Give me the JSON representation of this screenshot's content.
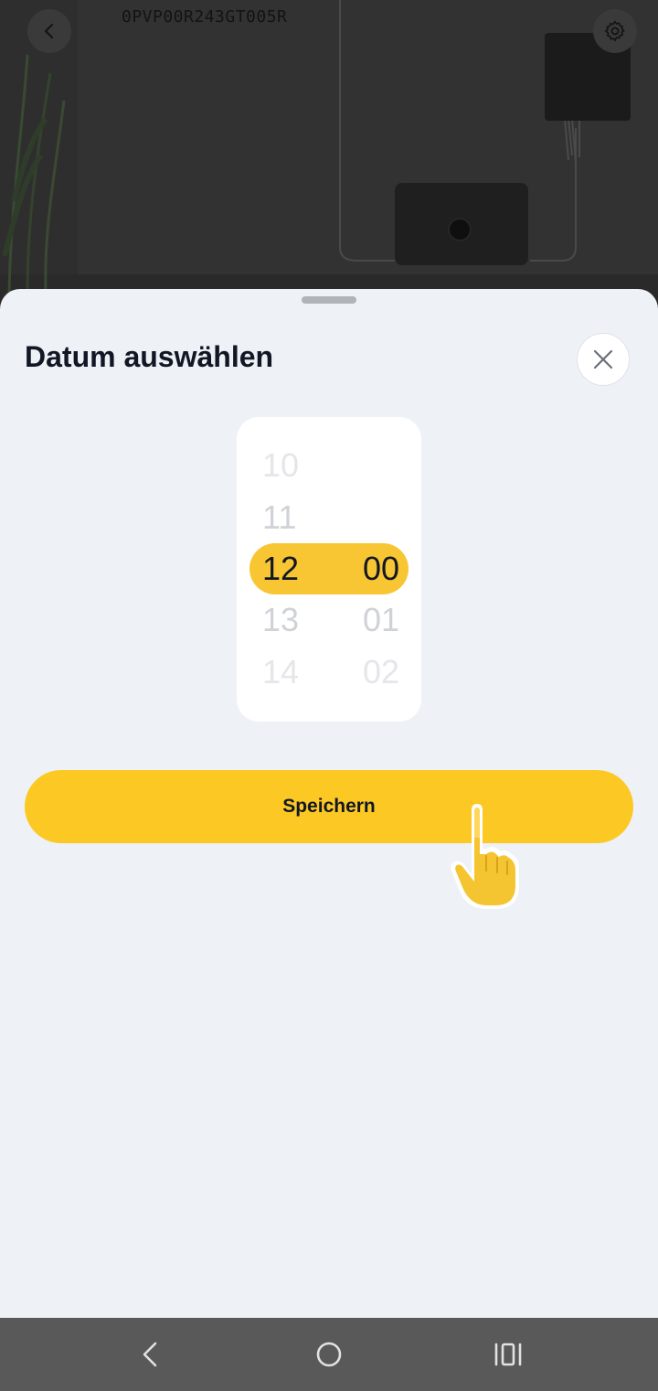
{
  "header": {
    "device_id": "0PVP00R243GT005R",
    "back_icon": "chevron-left-icon",
    "settings_icon": "gear-icon"
  },
  "sheet": {
    "title": "Datum auswählen",
    "close_icon": "close-icon"
  },
  "picker": {
    "hours": [
      "10",
      "11",
      "12",
      "13",
      "14"
    ],
    "minutes": [
      "",
      "",
      "00",
      "01",
      "02"
    ],
    "selected_hour": "12",
    "selected_minute": "00"
  },
  "actions": {
    "save_label": "Speichern"
  },
  "navbar": {
    "back_icon": "nav-back-icon",
    "home_icon": "nav-home-icon",
    "recents_icon": "nav-recents-icon"
  },
  "colors": {
    "accent": "#fcc823",
    "highlight": "#f8c632",
    "sheet_bg": "#eef1f5",
    "text_primary": "#121726",
    "picker_faded": "#cfd2d6"
  }
}
